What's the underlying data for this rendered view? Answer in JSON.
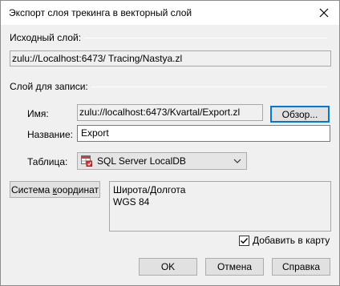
{
  "window": {
    "title": "Экспорт слоя трекинга в векторный слой"
  },
  "source_group": {
    "label": "Исходный слой:",
    "value": "zulu://Localhost:6473/ Tracing/Nastya.zl"
  },
  "target_group": {
    "label": "Слой для записи:",
    "name_label": "Имя:",
    "name_value": "zulu://localhost:6473/Kvartal/Export.zl",
    "browse_label": "Обзор...",
    "title_label": "Название:",
    "title_value": "Export",
    "table_label": "Таблица:",
    "table_value": "SQL Server LocalDB"
  },
  "coords": {
    "button_prefix": "Система ",
    "button_accel": "к",
    "button_suffix": "оординат",
    "line1": "Широта/Долгота",
    "line2": "WGS 84"
  },
  "add_to_map": {
    "label": "Добавить в карту",
    "checked": true
  },
  "footer": {
    "ok": "OK",
    "cancel": "Отмена",
    "help": "Справка"
  }
}
